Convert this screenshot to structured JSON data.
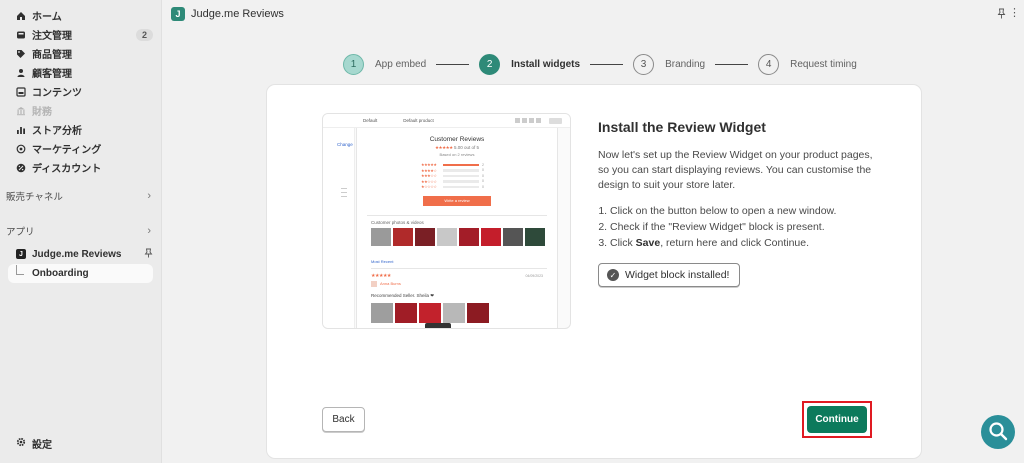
{
  "sidebar": {
    "items": [
      {
        "label": "ホーム",
        "icon": "home-icon"
      },
      {
        "label": "注文管理",
        "icon": "orders-icon",
        "badge": "2"
      },
      {
        "label": "商品管理",
        "icon": "tag-icon"
      },
      {
        "label": "顧客管理",
        "icon": "person-icon"
      },
      {
        "label": "コンテンツ",
        "icon": "content-icon"
      },
      {
        "label": "財務",
        "icon": "bank-icon",
        "disabled": true
      },
      {
        "label": "ストア分析",
        "icon": "analytics-icon"
      },
      {
        "label": "マーケティング",
        "icon": "target-icon"
      },
      {
        "label": "ディスカウント",
        "icon": "discount-icon"
      }
    ],
    "sales_channels_label": "販売チャネル",
    "apps_label": "アプリ",
    "app_name": "Judge.me Reviews",
    "app_icon_letter": "J",
    "sub_item": "Onboarding",
    "settings_label": "設定"
  },
  "topbar": {
    "logo_letter": "J",
    "title": "Judge.me Reviews"
  },
  "stepper": [
    {
      "num": "1",
      "label": "App embed",
      "state": "done"
    },
    {
      "num": "2",
      "label": "Install widgets",
      "state": "active"
    },
    {
      "num": "3",
      "label": "Branding",
      "state": "pending"
    },
    {
      "num": "4",
      "label": "Request timing",
      "state": "pending"
    }
  ],
  "preview": {
    "toolbar_left": "Default",
    "toolbar_product": "Default product",
    "side_chip": "Change",
    "title": "Customer Reviews",
    "stars_text": "5.00 out of 5",
    "based_on": "Based on 2 reviews",
    "hist": [
      {
        "stars": "★★★★★",
        "count": "2"
      },
      {
        "stars": "★★★★☆",
        "count": "0"
      },
      {
        "stars": "★★★☆☆",
        "count": "0"
      },
      {
        "stars": "★★☆☆☆",
        "count": "0"
      },
      {
        "stars": "★☆☆☆☆",
        "count": "0"
      }
    ],
    "write_label": "Write a review",
    "photos_label": "Customer photos & videos",
    "most_recent": "Most Recent",
    "review_stars": "★★★★★",
    "review_date": "04/09/2023",
    "review_name": "Anna Burns",
    "review_text": "Recommended Seller. Sheila ❤"
  },
  "content": {
    "heading": "Install the Review Widget",
    "description": "Now let's set up the Review Widget on your product pages, so you can start displaying reviews. You can customise the design to suit your store later.",
    "step1": "Click on the button below to open a new window.",
    "step2": "Check if the \"Review Widget\" block is present.",
    "step3_pre": "Click ",
    "step3_bold": "Save",
    "step3_post": ", return here and click Continue.",
    "installed_button": "Widget block installed!"
  },
  "footer": {
    "back": "Back",
    "continue": "Continue"
  },
  "colors": {
    "accent": "#2e8a78",
    "primary_button": "#0c7a5c",
    "highlight": "#e01a22",
    "review_orange": "#f06e4a",
    "fab": "#2a8f99"
  }
}
